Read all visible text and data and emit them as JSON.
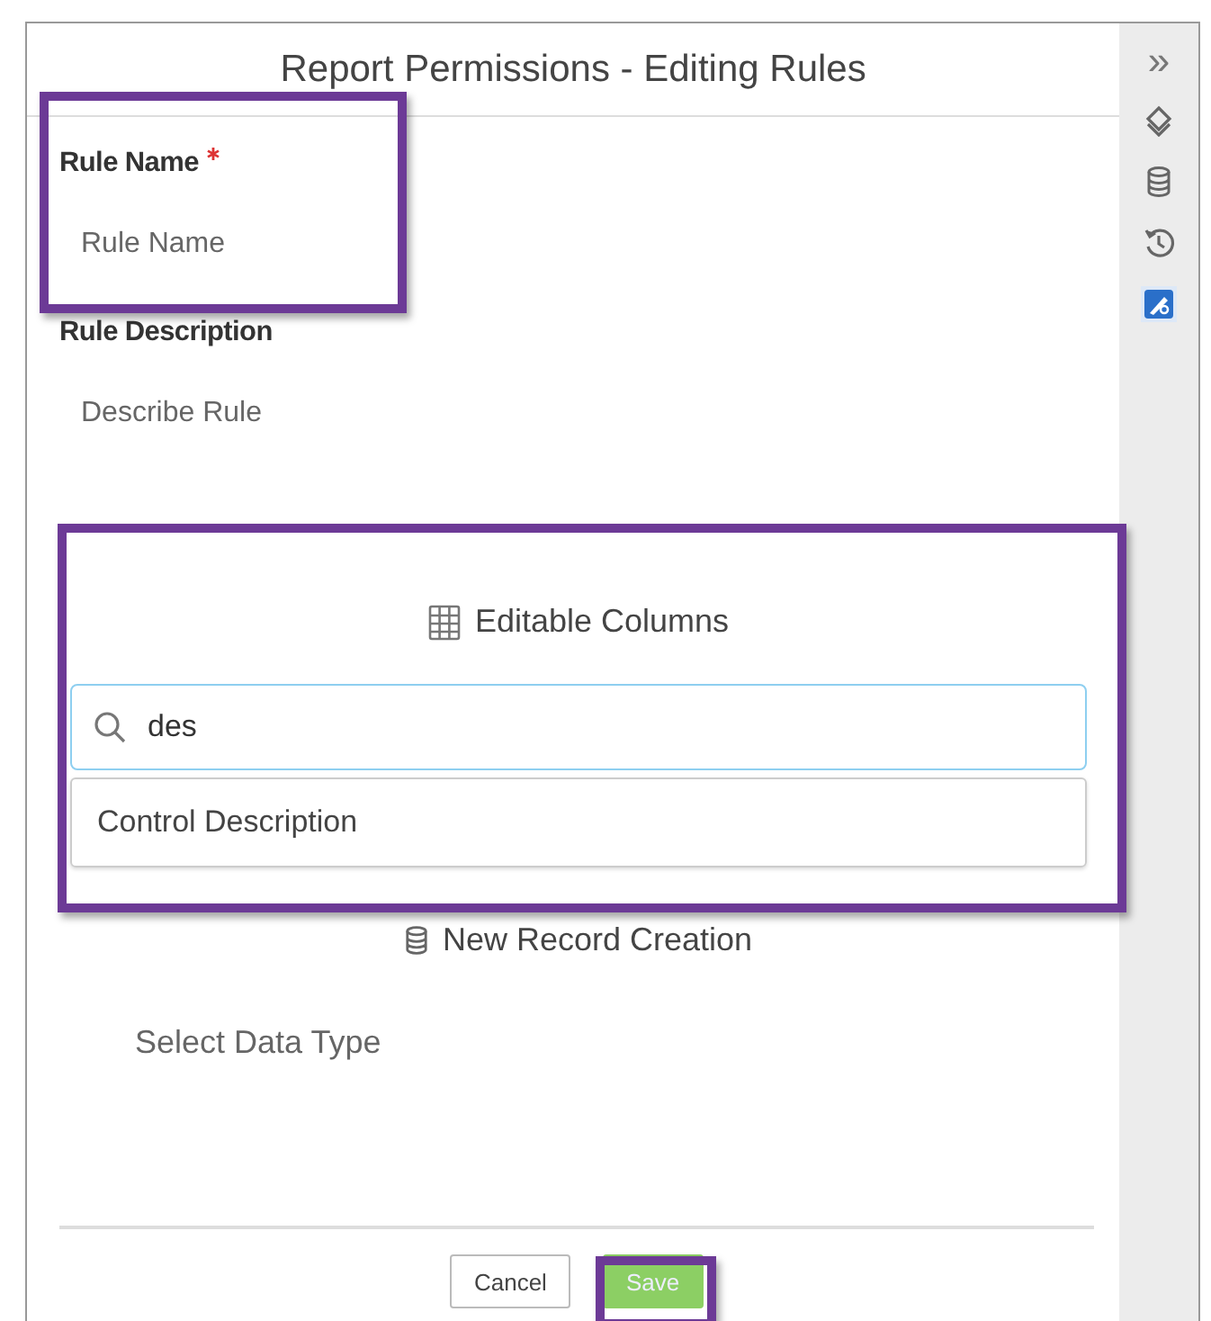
{
  "dialog": {
    "title": "Report Permissions - Editing Rules"
  },
  "fields": [
    {
      "label": "Rule Name",
      "required": true,
      "placeholder": "Rule Name"
    },
    {
      "label": "Rule Description",
      "required": false,
      "placeholder": "Describe Rule"
    }
  ],
  "editable_columns": {
    "heading": "Editable Columns",
    "search_value": "des",
    "options": [
      "Control Description"
    ]
  },
  "new_record": {
    "heading": "New Record Creation",
    "placeholder": "Select Data Type"
  },
  "buttons": [
    {
      "label": "Cancel",
      "kind": "secondary"
    },
    {
      "label": "Save",
      "kind": "primary"
    }
  ],
  "rail": {
    "collapse": "»",
    "tools": [
      {
        "kind": "layers",
        "selected": false
      },
      {
        "kind": "database",
        "selected": false
      },
      {
        "kind": "history",
        "selected": false
      },
      {
        "kind": "edit",
        "selected": true
      }
    ]
  }
}
